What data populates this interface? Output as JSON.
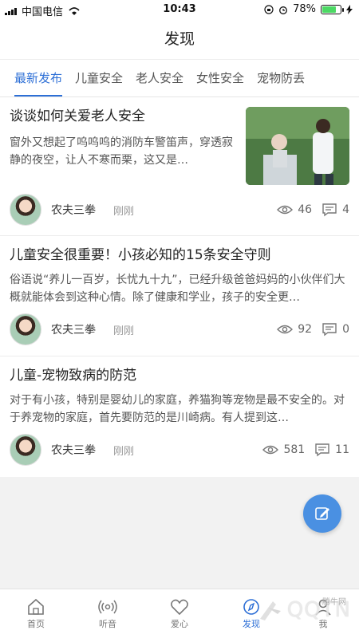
{
  "status_bar": {
    "carrier": "中国电信",
    "time": "10:43",
    "battery": "78%"
  },
  "nav": {
    "title": "发现"
  },
  "tabs": [
    "最新发布",
    "儿童安全",
    "老人安全",
    "女性安全",
    "宠物防丢"
  ],
  "articles": [
    {
      "title": "谈谈如何关爱老人安全",
      "summary": "窗外又想起了呜呜呜的消防车警笛声，穿透寂静的夜空，让人不寒而栗，这又是…",
      "author": "农夫三拳",
      "time": "刚刚",
      "views": "46",
      "comments": "4"
    },
    {
      "title": "儿童安全很重要！小孩必知的15条安全守则",
      "summary": "俗语说“养儿一百岁，长忧九十九”，已经升级爸爸妈妈的小伙伴们大概就能体会到这种心情。除了健康和学业，孩子的安全更…",
      "author": "农夫三拳",
      "time": "刚刚",
      "views": "92",
      "comments": "0"
    },
    {
      "title": "儿童-宠物致病的防范",
      "summary": "对于有小孩，特别是婴幼儿的家庭，养猫狗等宠物是最不安全的。对于养宠物的家庭，首先要防范的是川崎病。有人提到这…",
      "author": "农夫三拳",
      "time": "刚刚",
      "views": "581",
      "comments": "11"
    }
  ],
  "bottom_tabs": [
    {
      "label": "首页",
      "icon": "home-icon"
    },
    {
      "label": "听音",
      "icon": "broadcast-icon"
    },
    {
      "label": "爱心",
      "icon": "heart-icon"
    },
    {
      "label": "发现",
      "icon": "compass-icon"
    },
    {
      "label": "我",
      "icon": "user-icon"
    }
  ],
  "watermark": {
    "text": "QQTN",
    "small": "腾牛网"
  },
  "colors": {
    "accent": "#2d6fd6",
    "fab": "#4a90e2"
  }
}
